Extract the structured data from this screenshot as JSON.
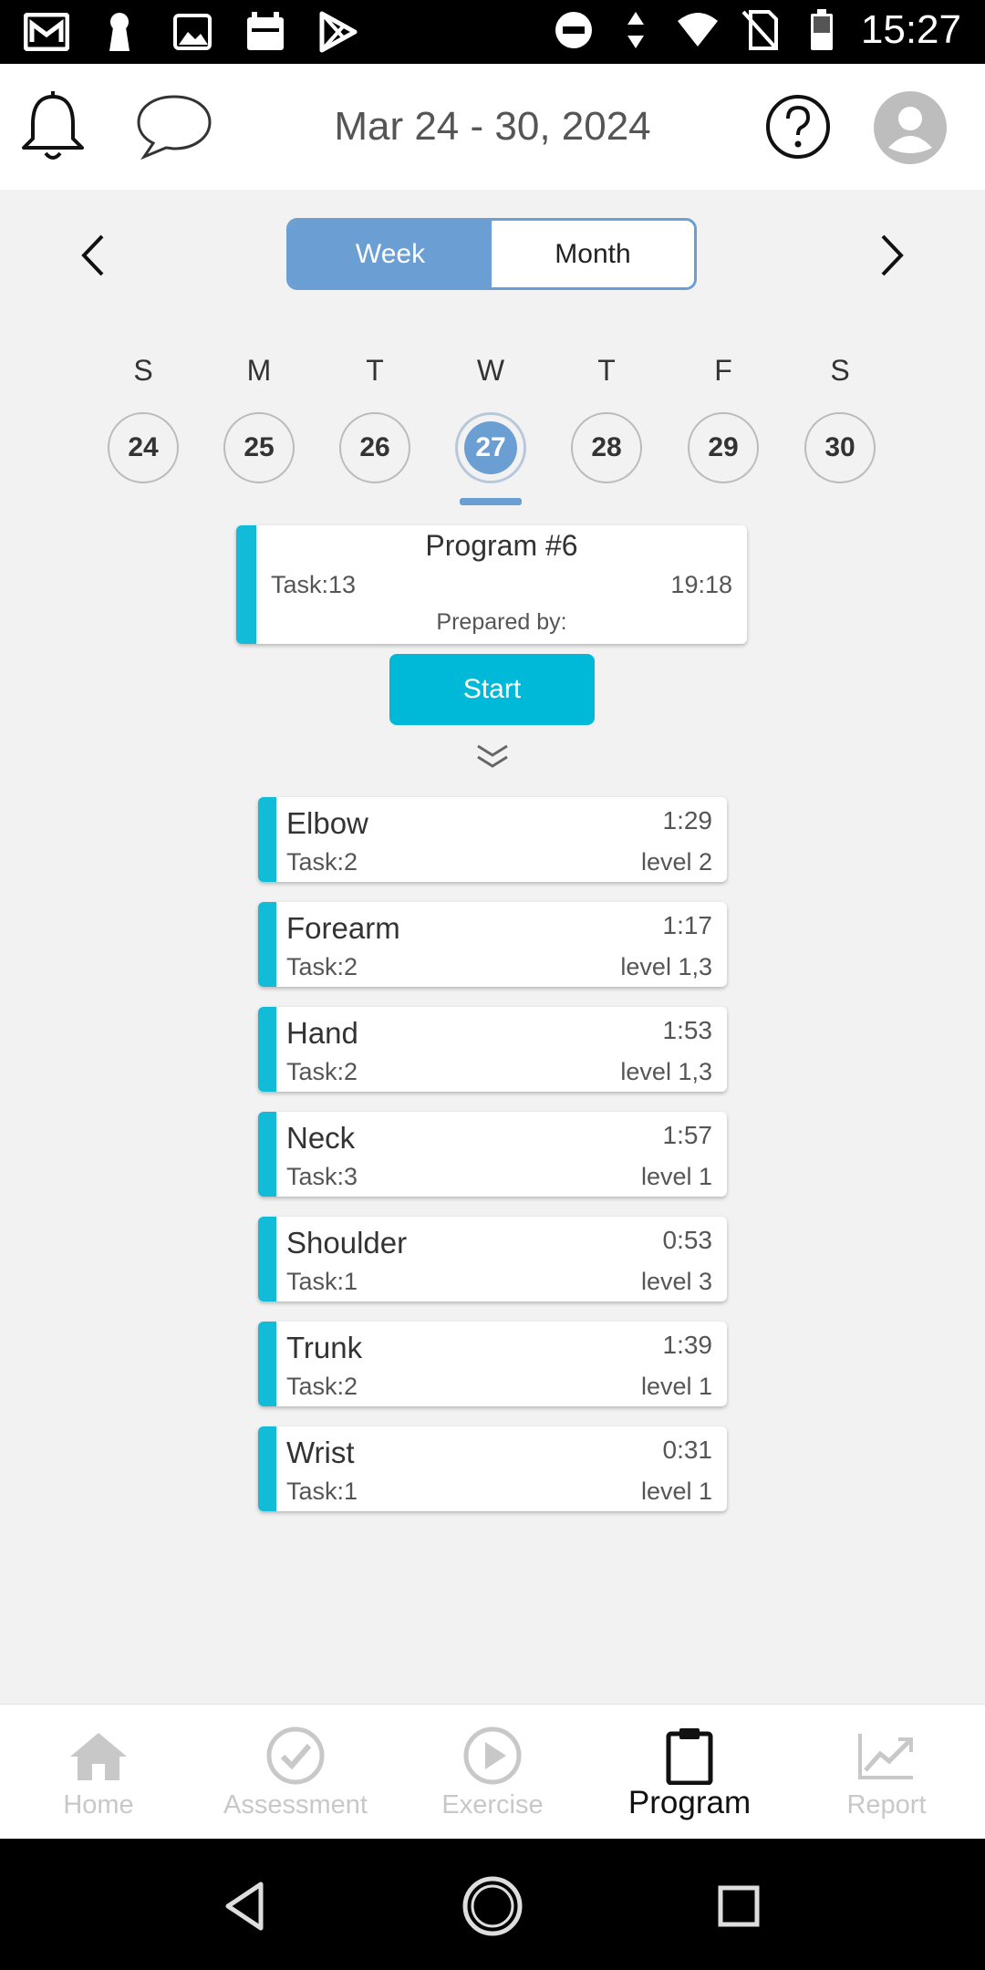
{
  "status_bar": {
    "time": "15:27",
    "left_icons": [
      "gmail-icon",
      "keyhole-icon",
      "image-icon",
      "calendar-icon",
      "play-store-icon"
    ],
    "right_icons": [
      "dnd-icon",
      "data-arrows-icon",
      "wifi-icon",
      "no-sim-icon",
      "battery-icon"
    ]
  },
  "header": {
    "title": "Mar 24 - 30, 2024",
    "icons": [
      "bell-icon",
      "chat-icon",
      "help-icon",
      "avatar-icon"
    ]
  },
  "view_toggle": {
    "week_label": "Week",
    "month_label": "Month",
    "active": "Week"
  },
  "week": {
    "days": [
      {
        "letter": "S",
        "num": "24"
      },
      {
        "letter": "M",
        "num": "25"
      },
      {
        "letter": "T",
        "num": "26"
      },
      {
        "letter": "W",
        "num": "27",
        "selected": true
      },
      {
        "letter": "T",
        "num": "28"
      },
      {
        "letter": "F",
        "num": "29"
      },
      {
        "letter": "S",
        "num": "30"
      }
    ]
  },
  "program": {
    "title": "Program #6",
    "task": "Task:13",
    "time": "19:18",
    "prepared_by": "Prepared by:",
    "start_label": "Start"
  },
  "tasks": [
    {
      "name": "Elbow",
      "time": "1:29",
      "count": "Task:2",
      "level": "level 2"
    },
    {
      "name": "Forearm",
      "time": "1:17",
      "count": "Task:2",
      "level": "level 1,3"
    },
    {
      "name": "Hand",
      "time": "1:53",
      "count": "Task:2",
      "level": "level 1,3"
    },
    {
      "name": "Neck",
      "time": "1:57",
      "count": "Task:3",
      "level": "level 1"
    },
    {
      "name": "Shoulder",
      "time": "0:53",
      "count": "Task:1",
      "level": "level 3"
    },
    {
      "name": "Trunk",
      "time": "1:39",
      "count": "Task:2",
      "level": "level 1"
    },
    {
      "name": "Wrist",
      "time": "0:31",
      "count": "Task:1",
      "level": "level 1"
    }
  ],
  "bottom_nav": {
    "items": [
      {
        "label": "Home",
        "icon": "home-icon"
      },
      {
        "label": "Assessment",
        "icon": "check-circle-icon"
      },
      {
        "label": "Exercise",
        "icon": "play-circle-icon"
      },
      {
        "label": "Program",
        "icon": "clipboard-icon",
        "active": true
      },
      {
        "label": "Report",
        "icon": "trend-chart-icon"
      }
    ]
  },
  "colors": {
    "accent_blue": "#6b9ed2",
    "cyan": "#00b8d8",
    "stripe": "#12bcd8",
    "background": "#f2f2f2"
  }
}
